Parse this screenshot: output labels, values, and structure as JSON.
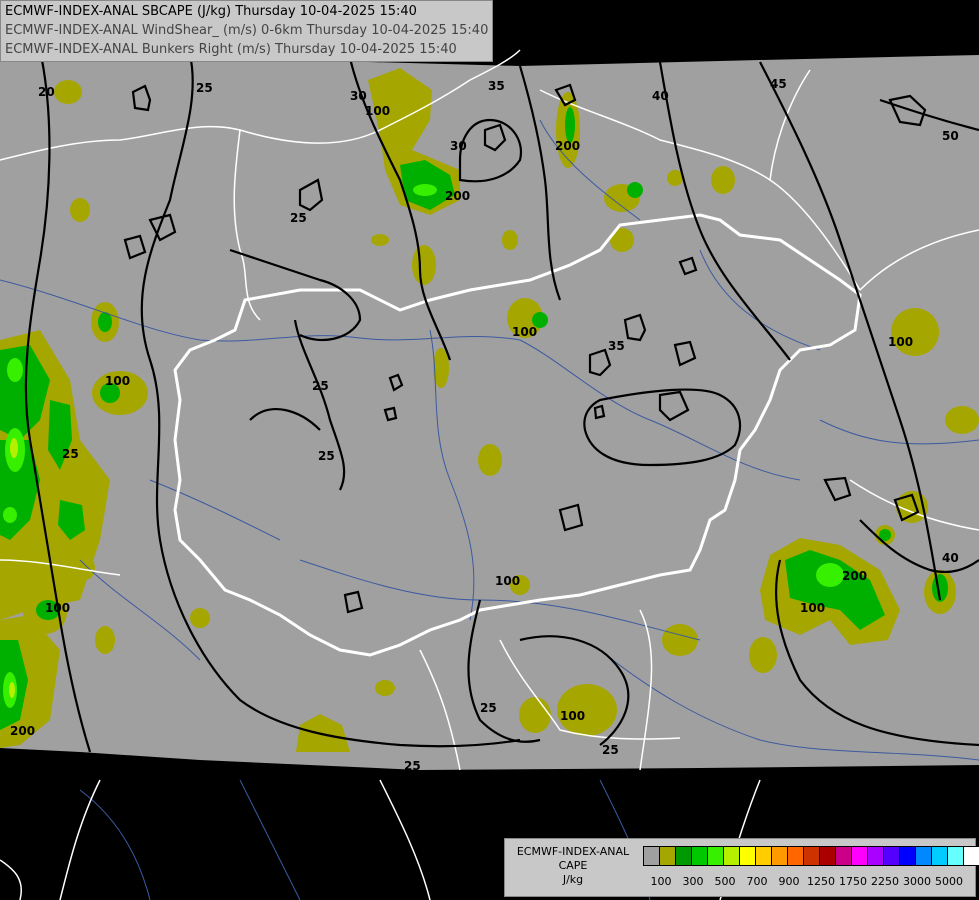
{
  "header": {
    "line1": "ECMWF-INDEX-ANAL SBCAPE (J/kg) Thursday 10-04-2025 15:40",
    "line2": "ECMWF-INDEX-ANAL WindShear_ (m/s) 0-6km Thursday 10-04-2025 15:40",
    "line3": "ECMWF-INDEX-ANAL Bunkers Right (m/s) Thursday 10-04-2025 15:40"
  },
  "legend": {
    "title_line1": "ECMWF-INDEX-ANAL",
    "title_line2": "CAPE",
    "title_line3": "J/kg",
    "colors": [
      "#a0a0a0",
      "#a6a600",
      "#009a00",
      "#00c800",
      "#36f000",
      "#b4f000",
      "#ffff00",
      "#ffcc00",
      "#ff9900",
      "#ff6600",
      "#cc3300",
      "#aa0000",
      "#cc0088",
      "#ff00ff",
      "#aa00ff",
      "#5500ff",
      "#0000ff",
      "#0088ff",
      "#00ccff",
      "#66ffff",
      "#ffffff"
    ],
    "ticks": [
      "100",
      "300",
      "500",
      "700",
      "900",
      "1250",
      "1750",
      "2250",
      "3000",
      "5000"
    ]
  },
  "contour_labels": [
    "20",
    "25",
    "30",
    "35",
    "40",
    "45",
    "50",
    "25",
    "30",
    "25",
    "25",
    "35",
    "25",
    "40",
    "25",
    "25",
    "25"
  ],
  "cape_labels": [
    "100",
    "100",
    "100",
    "100",
    "100",
    "100",
    "100",
    "100",
    "200",
    "200",
    "200",
    "200"
  ],
  "colors": {
    "background": "#000000",
    "domain": "#a0a0a0",
    "cape_low": "#a6a600",
    "cape_mid": "#00c800",
    "cape_high": "#36f000",
    "borders": "#ffffff",
    "rivers": "#3c5aa0",
    "contours": "#000000"
  }
}
